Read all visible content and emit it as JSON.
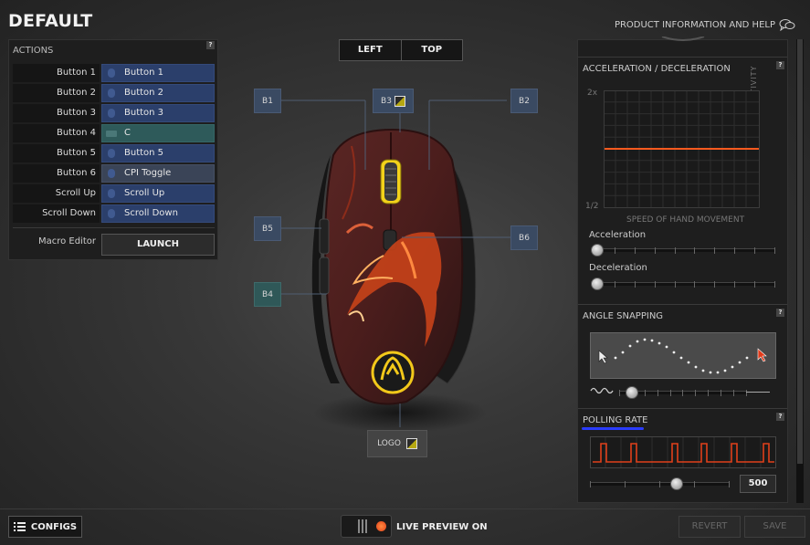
{
  "app": {
    "title": "DEFAULT",
    "help_label": "PRODUCT INFORMATION AND HELP"
  },
  "actions": {
    "title": "ACTIONS",
    "help": "?",
    "rows": [
      {
        "button": "Button 1",
        "action": "Button 1",
        "style": "blue"
      },
      {
        "button": "Button 2",
        "action": "Button 2",
        "style": "blue"
      },
      {
        "button": "Button 3",
        "action": "Button 3",
        "style": "blue"
      },
      {
        "button": "Button 4",
        "action": "C",
        "style": "teal"
      },
      {
        "button": "Button 5",
        "action": "Button 5",
        "style": "blue"
      },
      {
        "button": "Button 6",
        "action": "CPI Toggle",
        "style": "grey"
      },
      {
        "button": "Scroll Up",
        "action": "Scroll Up",
        "style": "blue"
      },
      {
        "button": "Scroll Down",
        "action": "Scroll Down",
        "style": "blue"
      }
    ],
    "macro_label": "Macro Editor",
    "launch_label": "LAUNCH"
  },
  "view_toggle": {
    "left": "LEFT",
    "top": "TOP",
    "selected": "TOP"
  },
  "callouts": {
    "b1": "B1",
    "b2": "B2",
    "b3": "B3",
    "b4": "B4",
    "b5": "B5",
    "b6": "B6",
    "logo": "LOGO"
  },
  "acceleration": {
    "title": "ACCELERATION / DECELERATION",
    "help": "?",
    "y_top": "2x",
    "y_bottom": "1/2",
    "y_label": "SENSITIVITY",
    "x_label": "SPEED OF HAND MOVEMENT",
    "accel_label": "Acceleration",
    "decel_label": "Deceleration",
    "accel_value": 0,
    "decel_value": 0,
    "line_color": "#ff5a1f"
  },
  "angle_snapping": {
    "title": "ANGLE SNAPPING",
    "help": "?",
    "value": 0.1
  },
  "polling_rate": {
    "title": "POLLING RATE",
    "help": "?",
    "value": "500",
    "slider_fraction": 0.62,
    "wave_color": "#e0401a"
  },
  "bottom": {
    "configs_label": "CONFIGS",
    "live_preview_label": "LIVE PREVIEW ON",
    "revert_label": "REVERT",
    "save_label": "SAVE"
  },
  "colors": {
    "accent_orange": "#ff5a1f",
    "action_blue": "#2b3f6b",
    "action_teal": "#2e5a5a"
  }
}
